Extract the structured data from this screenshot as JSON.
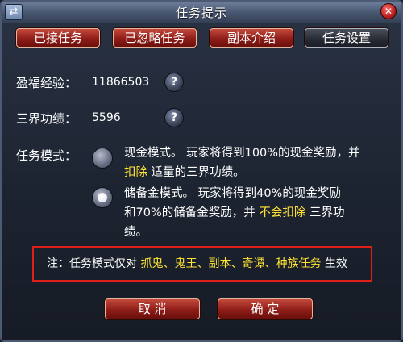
{
  "window": {
    "title": "任务提示"
  },
  "tabs": [
    {
      "label": "已接任务"
    },
    {
      "label": "已忽略任务"
    },
    {
      "label": "副本介绍"
    },
    {
      "label": "任务设置"
    }
  ],
  "stats": {
    "bonus_exp_label": "盈福经验：",
    "bonus_exp_value": "11866503",
    "merit_label": "三界功绩：",
    "merit_value": "5596"
  },
  "mode": {
    "label": "任务模式：",
    "cash": {
      "line1": "现金模式。 玩家将得到100%的现金奖励，并",
      "highlight": "扣除",
      "line2_rest": " 适量的三界功绩。"
    },
    "reserve": {
      "line1": "储备金模式。 玩家将得到40%的现金奖励",
      "line2_prefix": "和70%的储备金奖励，并 ",
      "highlight": "不会扣除",
      "line2_suffix": " 三界功",
      "line3": "绩。"
    }
  },
  "note": {
    "prefix": "注：任务模式仅对 ",
    "highlight": "抓鬼、鬼王、副本、奇谭、种族任务",
    "suffix": " 生效"
  },
  "buttons": {
    "cancel": "取 消",
    "confirm": "确 定"
  },
  "colors": {
    "highlight": "#ffe433",
    "note_border": "#e01f16",
    "button_red": "#8e1d18"
  }
}
